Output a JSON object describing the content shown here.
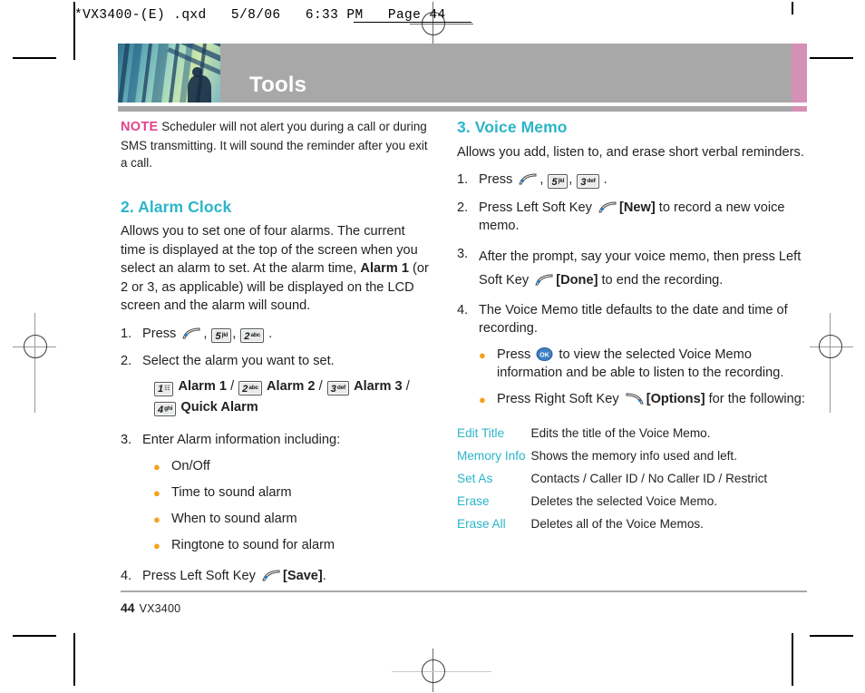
{
  "prepress": {
    "file_line": "*VX3400-(E) .qxd   5/8/06   6:33 PM   Page 44"
  },
  "banner": {
    "title": "Tools",
    "photo_alt": "abstract-blue-green-photo",
    "accent_gray": "#a8a8a8",
    "accent_pink": "#d391b6"
  },
  "note": {
    "label": "NOTE",
    "text": "Scheduler will not alert you during a call or during SMS transmitting. It will sound the reminder after you exit a call."
  },
  "left_column": {
    "section": {
      "heading": "2. Alarm Clock",
      "intro_1": "Allows you to set one of four alarms. The current time is displayed at the top of the screen when you select an alarm to set. At the alarm time, ",
      "intro_bold": "Alarm 1",
      "intro_2": " (or 2 or 3, as applicable) will be displayed on the LCD screen and the alarm will sound.",
      "steps": [
        {
          "n": "1.",
          "pre": "Press ",
          "post": " ."
        },
        {
          "n": "2.",
          "text": "Select the alarm you want to set."
        },
        {
          "n": "3.",
          "text": "Enter Alarm information including:"
        },
        {
          "n": "4.",
          "pre": "Press Left Soft Key ",
          "bold": "[Save]",
          "post": "."
        }
      ],
      "alarm_choices": [
        {
          "key": "1",
          "letters": "",
          "label": "Alarm 1"
        },
        {
          "key": "2",
          "letters": "abc",
          "label": "Alarm 2"
        },
        {
          "key": "3",
          "letters": "def",
          "label": "Alarm 3"
        },
        {
          "key": "4",
          "letters": "ghi",
          "label": "Quick Alarm"
        }
      ],
      "separator": "/",
      "bullets": [
        "On/Off",
        "Time to sound alarm",
        "When to sound alarm",
        "Ringtone to sound for alarm"
      ],
      "step1_keys": [
        {
          "key": "5",
          "letters": "jkl"
        },
        {
          "key": "2",
          "letters": "abc"
        }
      ]
    }
  },
  "right_column": {
    "section": {
      "heading": "3. Voice Memo",
      "intro": "Allows you add, listen to, and erase short verbal reminders.",
      "steps": [
        {
          "n": "1.",
          "pre": "Press ",
          "post": " ."
        },
        {
          "n": "2.",
          "pre": "Press Left Soft Key ",
          "bold": "[New]",
          "post": " to record a new voice memo."
        },
        {
          "n": "3.",
          "pre": "After the prompt, say your voice memo, then press Left Soft Key ",
          "bold": "[Done]",
          "post": " to end the recording."
        },
        {
          "n": "4.",
          "text": "The Voice Memo title defaults to the date and time of recording."
        }
      ],
      "step1_keys": [
        {
          "key": "5",
          "letters": "jkl"
        },
        {
          "key": "3",
          "letters": "def"
        }
      ],
      "bullets": [
        {
          "pre": "Press ",
          "icon": "ok-key-icon",
          "post": " to view the selected Voice Memo information and be able to listen to the recording."
        },
        {
          "pre": "Press Right Soft Key ",
          "icon": "right-soft-key-icon",
          "bold": "[Options]",
          "post": " for the following:"
        }
      ],
      "options_table": [
        {
          "name": "Edit Title",
          "desc": "Edits the title of the Voice Memo."
        },
        {
          "name": "Memory Info",
          "desc": "Shows the memory info used and left."
        },
        {
          "name": "Set As",
          "desc": "Contacts / Caller ID / No Caller ID / Restrict"
        },
        {
          "name": "Erase",
          "desc": "Deletes the selected Voice Memo."
        },
        {
          "name": "Erase All",
          "desc": "Deletes all of the Voice Memos."
        }
      ]
    }
  },
  "footer": {
    "page_number": "44",
    "model": "VX3400"
  },
  "colors": {
    "heading_teal": "#2bb5c8",
    "note_pink": "#e5408e",
    "bullet_orange": "#f5a11b",
    "ok_blue": "#3c7fc4"
  }
}
